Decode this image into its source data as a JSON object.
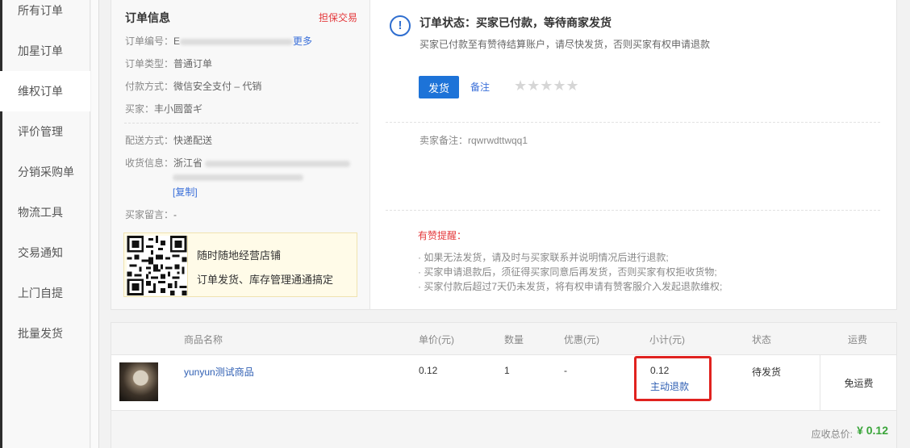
{
  "sidebar": {
    "items": [
      {
        "label": "所有订单"
      },
      {
        "label": "加星订单"
      },
      {
        "label": "维权订单"
      },
      {
        "label": "评价管理"
      },
      {
        "label": "分销采购单"
      },
      {
        "label": "物流工具"
      },
      {
        "label": "交易通知"
      },
      {
        "label": "上门自提"
      },
      {
        "label": "批量发货"
      }
    ],
    "active_index": 2
  },
  "order_info": {
    "title": "订单信息",
    "guarantee": "担保交易",
    "order_no_label": "订单编号：",
    "order_no_prefix": "E",
    "more_link": "更多",
    "order_type_label": "订单类型：",
    "order_type": "普通订单",
    "pay_label": "付款方式：",
    "pay_method": "微信安全支付 – 代销",
    "buyer_label": "买家：",
    "buyer": "丰小圆蕾ギ",
    "delivery_label": "配送方式：",
    "delivery": "快递配送",
    "address_label": "收货信息：",
    "address_prefix": "浙江省",
    "copy_link": "[复制]",
    "buyer_msg_label": "买家留言：",
    "buyer_msg": "-",
    "qr_title": "随时随地经营店铺",
    "qr_sub": "订单发货、库存管理通通搞定"
  },
  "status": {
    "icon": "info-icon",
    "title": "订单状态：买家已付款，等待商家发货",
    "desc": "买家已付款至有赞待结算账户，请尽快发货，否则买家有权申请退款",
    "ship_button": "发货",
    "note_link": "备注",
    "stars": "★★★★★",
    "star_rating": 0,
    "seller_note": "卖家备注：rqwrwdttwqq1",
    "tips_title": "有赞提醒：",
    "tips": [
      "· 如果无法发货，请及时与买家联系并说明情况后进行退款;",
      "· 买家申请退款后，须征得买家同意后再发货，否则买家有权拒收货物;",
      "· 买家付款后超过7天仍未发货，将有权申请有赞客服介入发起退款维权;"
    ]
  },
  "table": {
    "headers": [
      "商品名称",
      "单价(元)",
      "数量",
      "优惠(元)",
      "小计(元)",
      "状态",
      "运费"
    ],
    "row": {
      "name": "yunyun测试商品",
      "price": "0.12",
      "qty": "1",
      "discount": "-",
      "subtotal": "0.12",
      "refund_link": "主动退款",
      "status": "待发货",
      "shipping": "免运费"
    },
    "total_label": "应收总价:",
    "total_value": "¥ 0.12"
  },
  "colors": {
    "accent": "#1d73d8",
    "alert": "#e4393c",
    "highlight_box": "#e0221f",
    "total": "#3aa53a"
  }
}
